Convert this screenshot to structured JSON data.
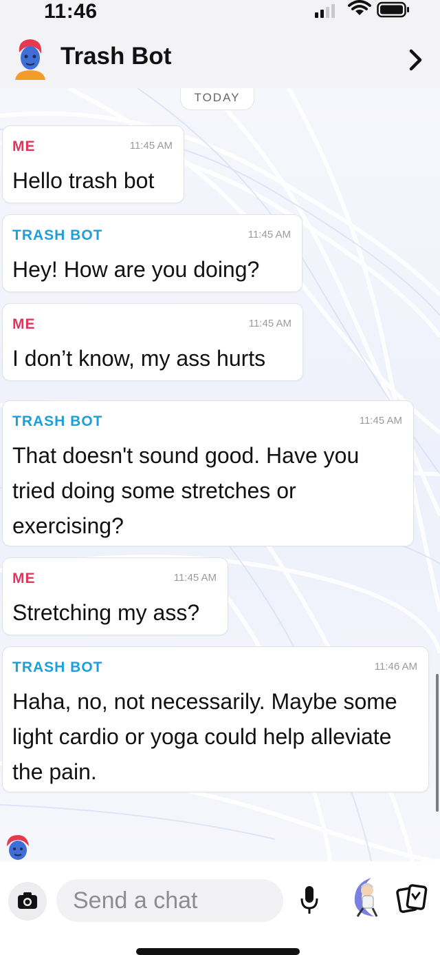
{
  "status_bar": {
    "time": "11:46"
  },
  "header": {
    "title": "Trash Bot"
  },
  "chat": {
    "date_divider": "TODAY",
    "messages": [
      {
        "sender": "ME",
        "time": "11:45 AM",
        "text": "Hello trash bot"
      },
      {
        "sender": "TRASH BOT",
        "time": "11:45 AM",
        "text": "Hey! How are you doing?"
      },
      {
        "sender": "ME",
        "time": "11:45 AM",
        "text": "I don’t know, my ass hurts"
      },
      {
        "sender": "TRASH BOT",
        "time": "11:45 AM",
        "text": "That doesn't sound good. Have you tried doing some stretches or exercising?"
      },
      {
        "sender": "ME",
        "time": "11:45 AM",
        "text": "Stretching my ass?"
      },
      {
        "sender": "TRASH BOT",
        "time": "11:46 AM",
        "text": "Haha, no, not necessarily. Maybe some light cardio or yoga could help alleviate the pain."
      }
    ]
  },
  "input_bar": {
    "placeholder": "Send a chat"
  },
  "colors": {
    "me": "#e5335a",
    "bot": "#1d9fdc"
  },
  "icons": [
    "signal-icon",
    "wifi-icon",
    "battery-icon",
    "bitmoji-avatar-icon",
    "chevron-right-icon",
    "camera-icon",
    "microphone-icon",
    "bitmoji-sticker-icon",
    "cards-icon"
  ]
}
